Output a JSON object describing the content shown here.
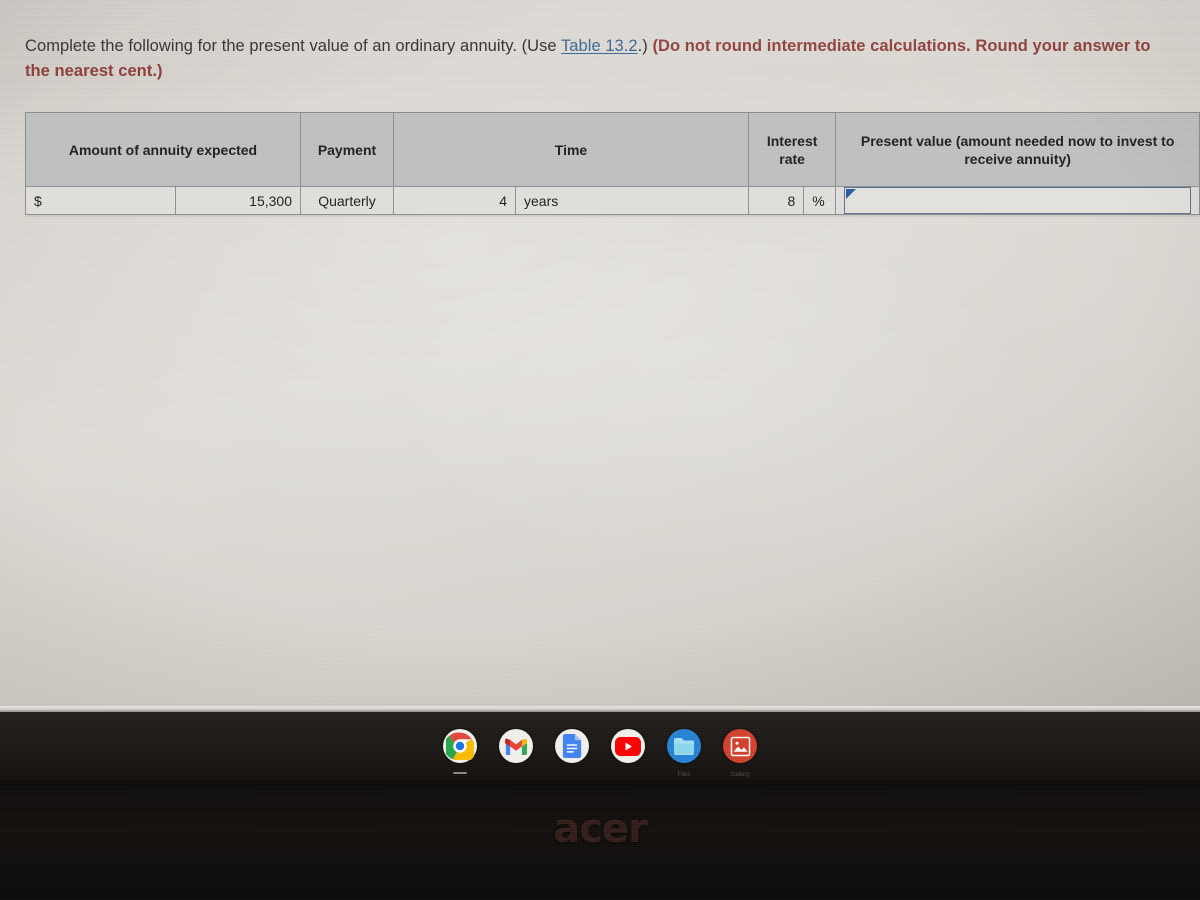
{
  "prompt": {
    "lead": "Complete the following for the present value of an ordinary annuity. (Use ",
    "link_text": "Table 13.2",
    "after_link": ".) ",
    "warning": "(Do not round intermediate calculations. Round your answer to the nearest cent.)",
    "link_color": "#33608f",
    "warning_color": "#8d3a36"
  },
  "table": {
    "headers": {
      "amount": "Amount of annuity expected",
      "payment": "Payment",
      "time": "Time",
      "interest_rate": "Interest rate",
      "present_value": "Present value (amount needed now to invest to receive annuity)"
    },
    "row": {
      "currency_symbol": "$",
      "amount": "15,300",
      "payment": "Quarterly",
      "time_value": "4",
      "time_unit": "years",
      "rate_value": "8",
      "rate_unit": "%",
      "present_value": "",
      "present_value_placeholder": ""
    },
    "header_bg": "#c1c3c4",
    "row_bg": "#e4e2de",
    "border_color": "#8f9193",
    "input_border_color": "#5d728c"
  },
  "taskbar": {
    "items": [
      {
        "name": "chrome-icon",
        "label": "Chrome",
        "running": true
      },
      {
        "name": "gmail-icon",
        "label": "Gmail",
        "running": false
      },
      {
        "name": "google-docs-icon",
        "label": "Docs",
        "running": false
      },
      {
        "name": "youtube-icon",
        "label": "YouTube",
        "running": false
      },
      {
        "name": "files-icon",
        "label": "Files",
        "running": false
      },
      {
        "name": "gallery-icon",
        "label": "Gallery",
        "running": false
      }
    ]
  },
  "device": {
    "brand": "acer"
  }
}
